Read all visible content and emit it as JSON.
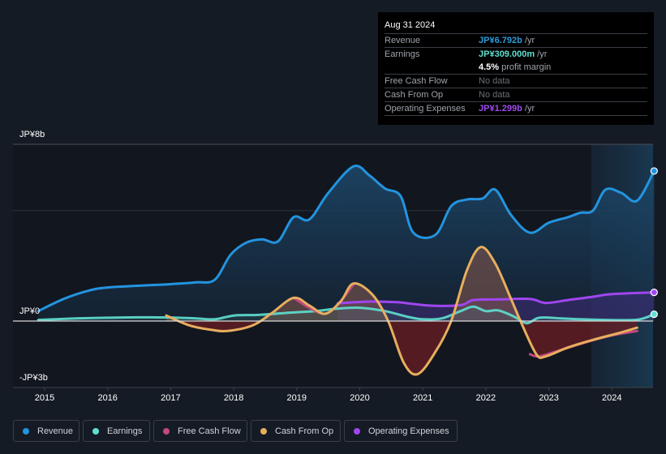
{
  "tooltip": {
    "date": "Aug 31 2024",
    "rows": [
      {
        "label": "Revenue",
        "value": "JP¥6.792b",
        "suffix": " /yr",
        "color": "#2d9cdb"
      },
      {
        "label": "Earnings",
        "value": "JP¥309.000m",
        "suffix": " /yr",
        "color": "#5fe0d0"
      },
      {
        "label": "",
        "value": "4.5%",
        "suffix": " profit margin",
        "color": "#ffffff"
      },
      {
        "label": "Free Cash Flow",
        "value": "No data",
        "suffix": "",
        "color": "#6b7079"
      },
      {
        "label": "Cash From Op",
        "value": "No data",
        "suffix": "",
        "color": "#6b7079"
      },
      {
        "label": "Operating Expenses",
        "value": "JP¥1.299b",
        "suffix": " /yr",
        "color": "#a04cf0"
      }
    ]
  },
  "legend": [
    {
      "label": "Revenue",
      "color": "#2394df"
    },
    {
      "label": "Earnings",
      "color": "#5fe0d0"
    },
    {
      "label": "Free Cash Flow",
      "color": "#c4487f"
    },
    {
      "label": "Cash From Op",
      "color": "#e8ae5e"
    },
    {
      "label": "Operating Expenses",
      "color": "#a046f0"
    }
  ],
  "chart_data": {
    "type": "area",
    "title": "",
    "xlabel": "",
    "ylabel": "",
    "ylim": [
      -3,
      8
    ],
    "xlim": [
      2014.9,
      2024.67
    ],
    "y_tick_labels": [
      {
        "value": 8,
        "label": "JP¥8b"
      },
      {
        "value": 0,
        "label": "JP¥0"
      },
      {
        "value": -3,
        "label": "-JP¥3b"
      }
    ],
    "y_gridlines": [
      8,
      5,
      0
    ],
    "x_ticks": [
      "2015",
      "2016",
      "2017",
      "2018",
      "2019",
      "2020",
      "2021",
      "2022",
      "2023",
      "2024"
    ],
    "highlight_range": [
      2023.67,
      2024.67
    ],
    "units": "JP¥ billions",
    "series": [
      {
        "name": "Revenue",
        "color": "#2394df",
        "points": [
          [
            2014.9,
            0.45
          ],
          [
            2015.3,
            1.0
          ],
          [
            2015.7,
            1.38
          ],
          [
            2016.0,
            1.52
          ],
          [
            2016.5,
            1.6
          ],
          [
            2017.0,
            1.67
          ],
          [
            2017.4,
            1.75
          ],
          [
            2017.7,
            1.87
          ],
          [
            2017.95,
            3.0
          ],
          [
            2018.2,
            3.55
          ],
          [
            2018.45,
            3.7
          ],
          [
            2018.7,
            3.6
          ],
          [
            2018.95,
            4.7
          ],
          [
            2019.2,
            4.6
          ],
          [
            2019.5,
            5.8
          ],
          [
            2019.9,
            7.0
          ],
          [
            2020.15,
            6.6
          ],
          [
            2020.4,
            6.0
          ],
          [
            2020.65,
            5.65
          ],
          [
            2020.85,
            4.0
          ],
          [
            2021.2,
            3.9
          ],
          [
            2021.45,
            5.2
          ],
          [
            2021.7,
            5.5
          ],
          [
            2021.95,
            5.55
          ],
          [
            2022.15,
            5.95
          ],
          [
            2022.4,
            4.8
          ],
          [
            2022.7,
            4.0
          ],
          [
            2023.0,
            4.45
          ],
          [
            2023.3,
            4.7
          ],
          [
            2023.5,
            4.9
          ],
          [
            2023.7,
            5.0
          ],
          [
            2023.9,
            5.95
          ],
          [
            2024.15,
            5.8
          ],
          [
            2024.4,
            5.45
          ],
          [
            2024.67,
            6.792
          ]
        ]
      },
      {
        "name": "Earnings",
        "color": "#5fe0d0",
        "points": [
          [
            2014.9,
            0.05
          ],
          [
            2015.5,
            0.12
          ],
          [
            2016.0,
            0.15
          ],
          [
            2016.5,
            0.17
          ],
          [
            2017.0,
            0.16
          ],
          [
            2017.4,
            0.12
          ],
          [
            2017.7,
            0.08
          ],
          [
            2018.0,
            0.25
          ],
          [
            2018.4,
            0.28
          ],
          [
            2018.9,
            0.38
          ],
          [
            2019.3,
            0.45
          ],
          [
            2019.6,
            0.55
          ],
          [
            2020.0,
            0.6
          ],
          [
            2020.4,
            0.45
          ],
          [
            2020.75,
            0.2
          ],
          [
            2021.0,
            0.08
          ],
          [
            2021.3,
            0.12
          ],
          [
            2021.6,
            0.45
          ],
          [
            2021.8,
            0.65
          ],
          [
            2022.0,
            0.45
          ],
          [
            2022.2,
            0.48
          ],
          [
            2022.45,
            0.2
          ],
          [
            2022.65,
            -0.1
          ],
          [
            2022.85,
            0.15
          ],
          [
            2023.2,
            0.12
          ],
          [
            2023.5,
            0.08
          ],
          [
            2023.9,
            0.05
          ],
          [
            2024.4,
            0.06
          ],
          [
            2024.67,
            0.309
          ]
        ]
      },
      {
        "name": "Free Cash Flow",
        "color": "#c4487f",
        "segments": [
          [
            [
              2018.95,
              1.05
            ],
            [
              2019.2,
              0.6
            ],
            [
              2019.45,
              0.33
            ],
            [
              2019.65,
              0.75
            ],
            [
              2019.9,
              1.65
            ]
          ],
          [
            [
              2022.7,
              -1.5
            ],
            [
              2022.85,
              -1.6
            ],
            [
              2023.2,
              -1.3
            ],
            [
              2023.6,
              -0.95
            ],
            [
              2024.0,
              -0.65
            ],
            [
              2024.4,
              -0.45
            ]
          ]
        ]
      },
      {
        "name": "Cash From Op",
        "color": "#e8ae5e",
        "points": [
          [
            2016.93,
            0.25
          ],
          [
            2017.3,
            -0.2
          ],
          [
            2017.65,
            -0.4
          ],
          [
            2017.9,
            -0.45
          ],
          [
            2018.3,
            -0.2
          ],
          [
            2018.6,
            0.35
          ],
          [
            2018.95,
            1.05
          ],
          [
            2019.2,
            0.7
          ],
          [
            2019.45,
            0.33
          ],
          [
            2019.7,
            0.9
          ],
          [
            2019.9,
            1.7
          ],
          [
            2020.2,
            1.2
          ],
          [
            2020.45,
            0.0
          ],
          [
            2020.7,
            -1.9
          ],
          [
            2020.92,
            -2.4
          ],
          [
            2021.2,
            -1.4
          ],
          [
            2021.45,
            0.0
          ],
          [
            2021.7,
            2.3
          ],
          [
            2021.92,
            3.35
          ],
          [
            2022.15,
            2.6
          ],
          [
            2022.4,
            1.0
          ],
          [
            2022.55,
            0.0
          ],
          [
            2022.8,
            -1.5
          ],
          [
            2022.95,
            -1.6
          ],
          [
            2023.3,
            -1.2
          ],
          [
            2023.7,
            -0.85
          ],
          [
            2024.1,
            -0.55
          ],
          [
            2024.4,
            -0.3
          ]
        ]
      },
      {
        "name": "Operating Expenses",
        "color": "#a046f0",
        "points": [
          [
            2019.65,
            0.8
          ],
          [
            2020.15,
            0.88
          ],
          [
            2020.6,
            0.85
          ],
          [
            2021.1,
            0.7
          ],
          [
            2021.6,
            0.72
          ],
          [
            2021.8,
            0.95
          ],
          [
            2022.2,
            0.98
          ],
          [
            2022.7,
            1.0
          ],
          [
            2022.95,
            0.82
          ],
          [
            2023.3,
            0.95
          ],
          [
            2023.7,
            1.1
          ],
          [
            2024.0,
            1.22
          ],
          [
            2024.67,
            1.299
          ]
        ]
      }
    ]
  }
}
